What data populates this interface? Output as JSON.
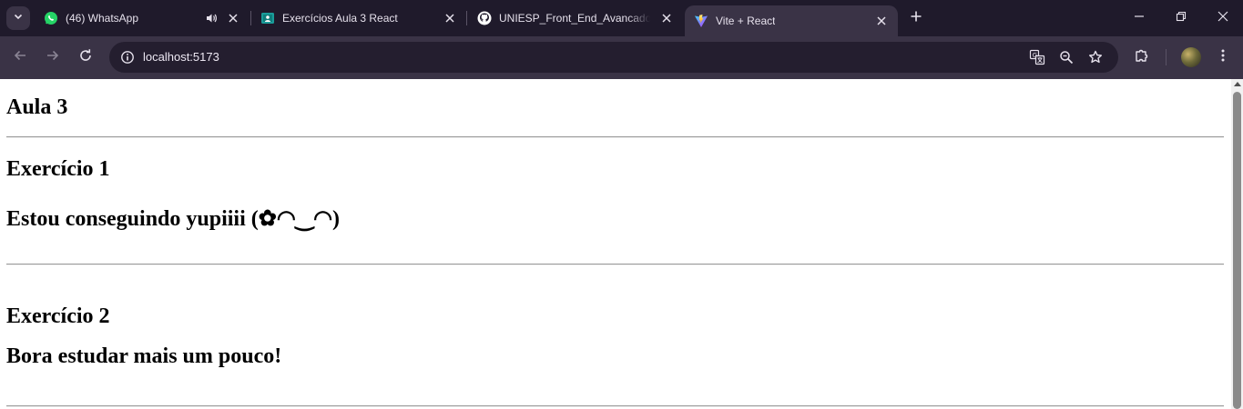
{
  "tabs": [
    {
      "title": "(46) WhatsApp",
      "icon": "whatsapp-icon",
      "audio_icon": "speaker-icon"
    },
    {
      "title": "Exercícios Aula 3 React",
      "icon": "classroom-icon"
    },
    {
      "title": "UNIESP_Front_End_Avancado_p",
      "icon": "github-icon"
    },
    {
      "title": "Vite + React",
      "icon": "vite-icon",
      "active": true
    }
  ],
  "toolbar": {
    "url": "localhost:5173"
  },
  "page": {
    "heading": "Aula 3",
    "exercise1": {
      "title": "Exercício 1",
      "message": "Estou conseguindo yupiiii (✿◠‿◠)"
    },
    "exercise2": {
      "title": "Exercício 2",
      "message": "Bora estudar mais um pouco!"
    }
  },
  "colors": {
    "tabstrip_bg": "#1f1a2b",
    "toolbar_bg": "#3a3346",
    "omnibox_bg": "#241e2f",
    "text_light": "#e6e1ec",
    "page_bg": "#ffffff",
    "whatsapp_green": "#25d366",
    "classroom_teal": "#1a9c9a"
  }
}
